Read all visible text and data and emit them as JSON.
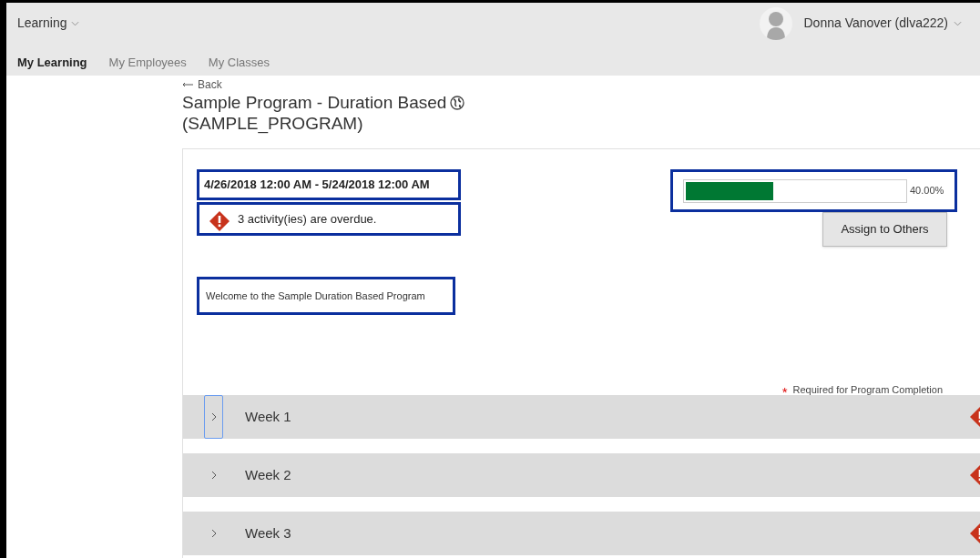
{
  "header": {
    "app_menu": "Learning",
    "user": {
      "name": "Donna Vanover (dlva222)"
    }
  },
  "tabs": [
    {
      "label": "My Learning",
      "selected": true
    },
    {
      "label": "My Employees",
      "selected": false
    },
    {
      "label": "My Classes",
      "selected": false
    }
  ],
  "back": "Back",
  "title": "Sample Program - Duration Based",
  "code": "(SAMPLE_PROGRAM)",
  "program": {
    "dates": "4/26/2018 12:00 AM - 5/24/2018 12:00 AM",
    "overdue": "3 activity(ies) are overdue.",
    "progress": {
      "level": 0.4,
      "reading": "40.00%"
    },
    "assign_button": "Assign to Others",
    "description": "Welcome to the Sample Duration Based Program",
    "required_mark": "*",
    "required_note": "Required for Program Completion"
  },
  "weeks": [
    {
      "label": "Week 1",
      "focused": true,
      "overdue": true
    },
    {
      "label": "Week 2",
      "focused": false,
      "overdue": true
    },
    {
      "label": "Week 3",
      "focused": false,
      "overdue": true
    }
  ]
}
